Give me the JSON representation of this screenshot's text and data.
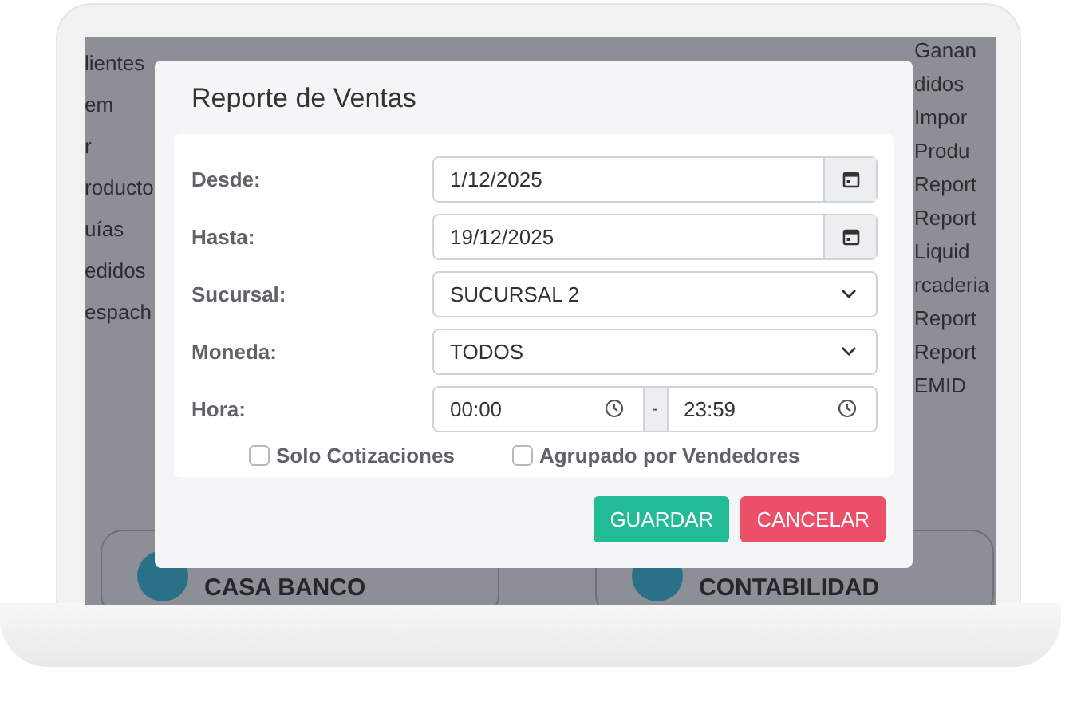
{
  "background": {
    "left_menu": [
      "lientes",
      "em",
      "r",
      "roducto",
      "uías",
      "edidos",
      "espach"
    ],
    "right_menu": [
      "Ganan",
      "didos",
      "Impor",
      "Produ",
      "Report",
      "Report",
      "Liquid",
      "rcaderia",
      "Report",
      "Report",
      "EMID"
    ],
    "cards": [
      "CASA BANCO",
      "CONTABILIDAD"
    ]
  },
  "dialog": {
    "title": "Reporte de Ventas",
    "fields": [
      {
        "kind": "date",
        "label": "Desde:",
        "value": "1/12/2025"
      },
      {
        "kind": "date",
        "label": "Hasta:",
        "value": "19/12/2025"
      },
      {
        "kind": "select",
        "label": "Sucursal:",
        "value": "SUCURSAL 2"
      },
      {
        "kind": "select",
        "label": "Moneda:",
        "value": "TODOS"
      },
      {
        "kind": "time_range",
        "label": "Hora:",
        "from": "00:00",
        "separator": "-",
        "to": "23:59"
      }
    ],
    "checkboxes": [
      {
        "label": "Solo Cotizaciones",
        "checked": false
      },
      {
        "label": "Agrupado por Vendedores",
        "checked": false
      }
    ],
    "buttons": [
      {
        "label": "GUARDAR",
        "kind": "primary"
      },
      {
        "label": "CANCELAR",
        "kind": "danger"
      }
    ]
  }
}
